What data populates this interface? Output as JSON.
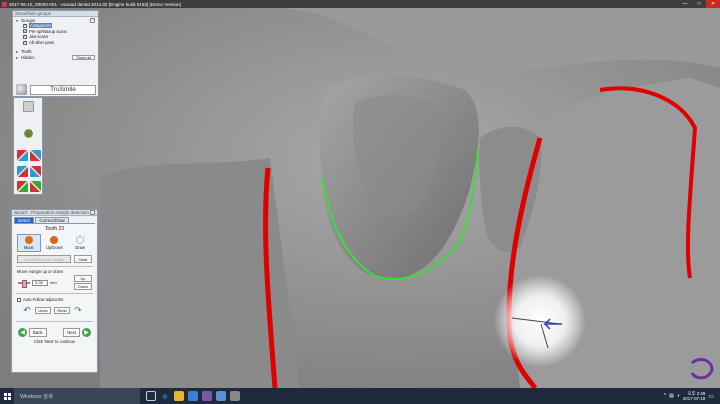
{
  "window": {
    "title": "2017-06-15_00003-001 - exocad dental 2014.02 [Engine build 5153] [Demo Version]",
    "controls": [
      "—",
      "□",
      "✕"
    ]
  },
  "show_hide": {
    "header": "Show/hide groups",
    "groups_label": "Groups",
    "help": "?",
    "items": [
      {
        "label": "Antagonists",
        "checked": true
      },
      {
        "label": "Pre-op/Waxup scans",
        "checked": true
      },
      {
        "label": "Jaw scans",
        "checked": true
      },
      {
        "label": "All other parts",
        "checked": true
      }
    ],
    "tooth_label": "Tooth",
    "hidden_label": "Hidden",
    "show_all": "Show all",
    "trusmile": "TruSmile"
  },
  "wizard": {
    "header": "wizard - Preparation margin detection",
    "help": "?",
    "tabs": [
      "Detect",
      "Correct/Draw"
    ],
    "active_tab": "Correct/Draw",
    "tooth": "Tooth 23",
    "tools": [
      {
        "label": "Move",
        "color": "#e36b12",
        "selected": true
      },
      {
        "label": "Up/Down",
        "color": "#d9661a",
        "selected": false
      },
      {
        "label": "Draw",
        "color": "#3b8bd6",
        "selected": false
      }
    ],
    "disabled_btn": "Smooth/Reduce Margin",
    "clear": "Clear",
    "margin_title": "Move margin up or down",
    "margin_value": "0.05",
    "margin_unit": "mm",
    "up": "Up",
    "down": "Down",
    "auto_follow": "Auto-Follow adjacents",
    "undo": "Undo",
    "redo": "Redo",
    "back": "Back",
    "next": "Next",
    "hint": "Click 'Next' to continue"
  },
  "taskbar": {
    "search": "Windows 검색",
    "time": "오후 2:49",
    "date": "2017-07-18"
  },
  "colors": {
    "margin_line": "#3ddc3d",
    "prep_margin": "#e00000",
    "model_surface": "#8f8f8f",
    "accent": "#2f64b8"
  }
}
